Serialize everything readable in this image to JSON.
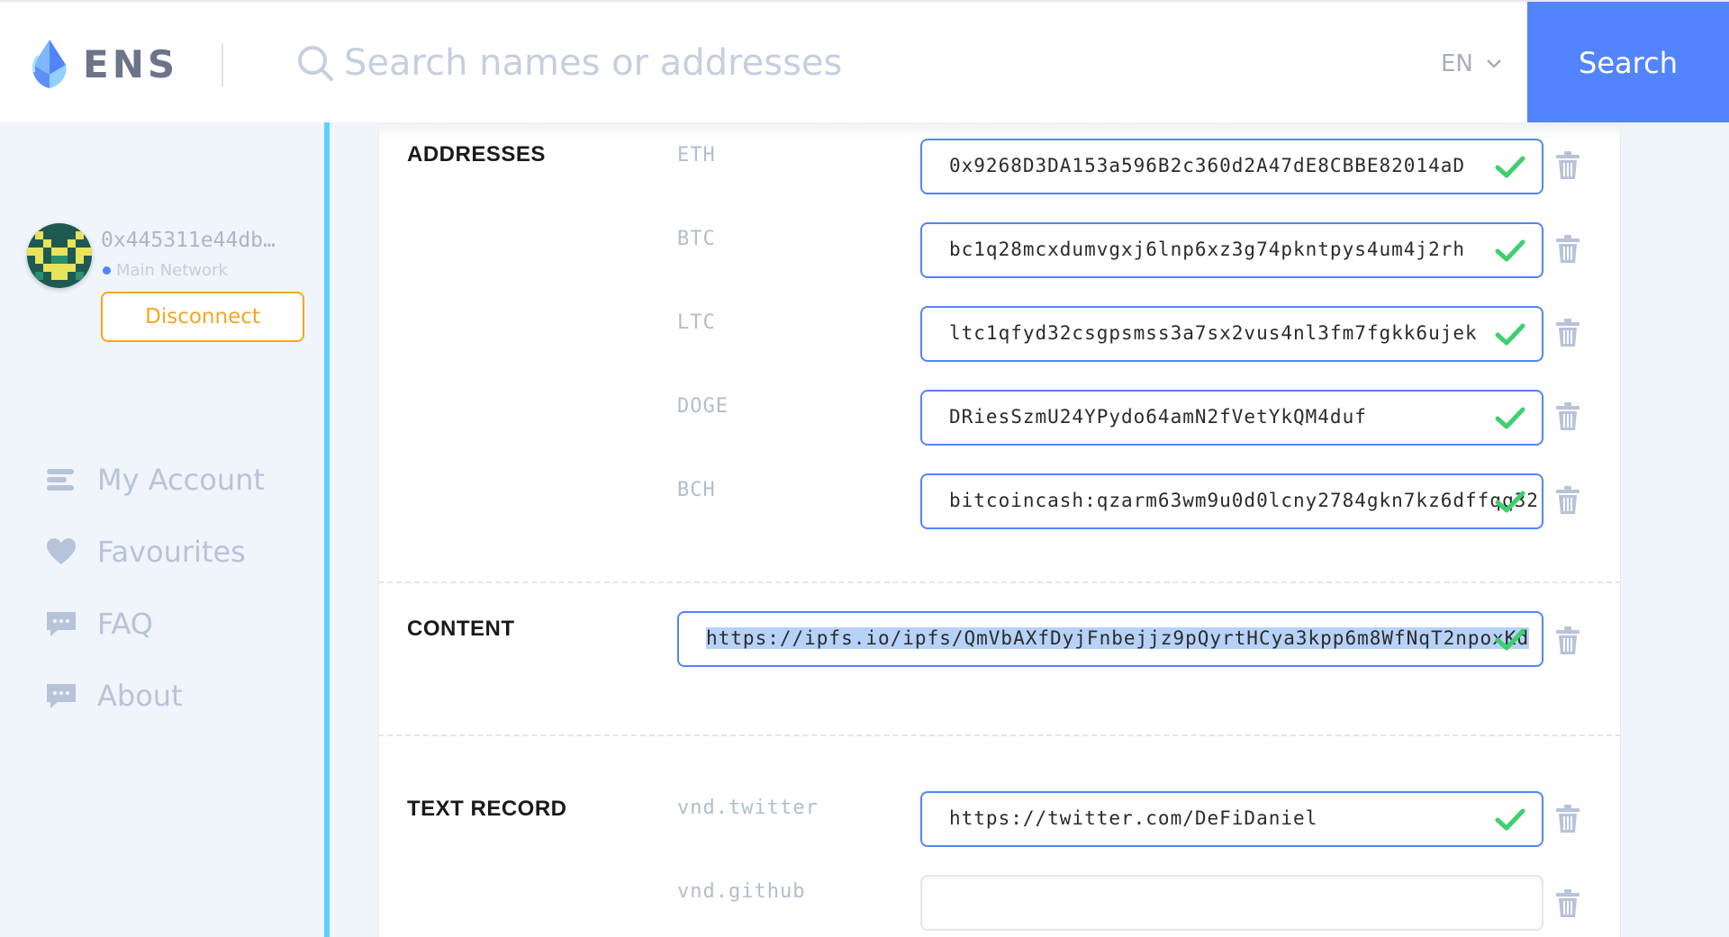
{
  "header": {
    "logo_text": "ENS",
    "search_placeholder": "Search names or addresses",
    "language": "EN",
    "search_button": "Search"
  },
  "account": {
    "address": "0x445311e44db…",
    "network": "Main Network",
    "disconnect_label": "Disconnect"
  },
  "nav": [
    {
      "label": "My Account",
      "icon": "list-icon"
    },
    {
      "label": "Favourites",
      "icon": "heart-icon"
    },
    {
      "label": "FAQ",
      "icon": "chat-bubble-icon"
    },
    {
      "label": "About",
      "icon": "chat-bubble-icon"
    }
  ],
  "sections": {
    "addresses": {
      "title": "ADDRESSES",
      "records": [
        {
          "key": "ETH",
          "value": "0x9268D3DA153a596B2c360d2A47dE8CBBE82014aD"
        },
        {
          "key": "BTC",
          "value": "bc1q28mcxdumvgxj6lnp6xz3g74pkntpys4um4j2rh"
        },
        {
          "key": "LTC",
          "value": "ltc1qfyd32csgpsmss3a7sx2vus4nl3fm7fgkk6ujek"
        },
        {
          "key": "DOGE",
          "value": "DRiesSzmU24YPydo64amN2fVetYkQM4duf"
        },
        {
          "key": "BCH",
          "value": "bitcoincash:qzarm63wm9u0d0lcny2784gkn7kz6dffqq32"
        }
      ]
    },
    "content": {
      "title": "CONTENT",
      "value": "https://ipfs.io/ipfs/QmVbAXfDyjFnbejjz9pQyrtHCya3kpp6m8WfNqT2npoxKd"
    },
    "text_record": {
      "title": "TEXT RECORD",
      "records": [
        {
          "key": "vnd.twitter",
          "value": "https://twitter.com/DeFiDaniel"
        },
        {
          "key": "vnd.github",
          "value": ""
        }
      ]
    }
  },
  "colors": {
    "accent_blue": "#5284ff",
    "check_green": "#3ecf6e",
    "disconnect_orange": "#f5a623",
    "sidebar_accent": "#5cd1ff"
  }
}
